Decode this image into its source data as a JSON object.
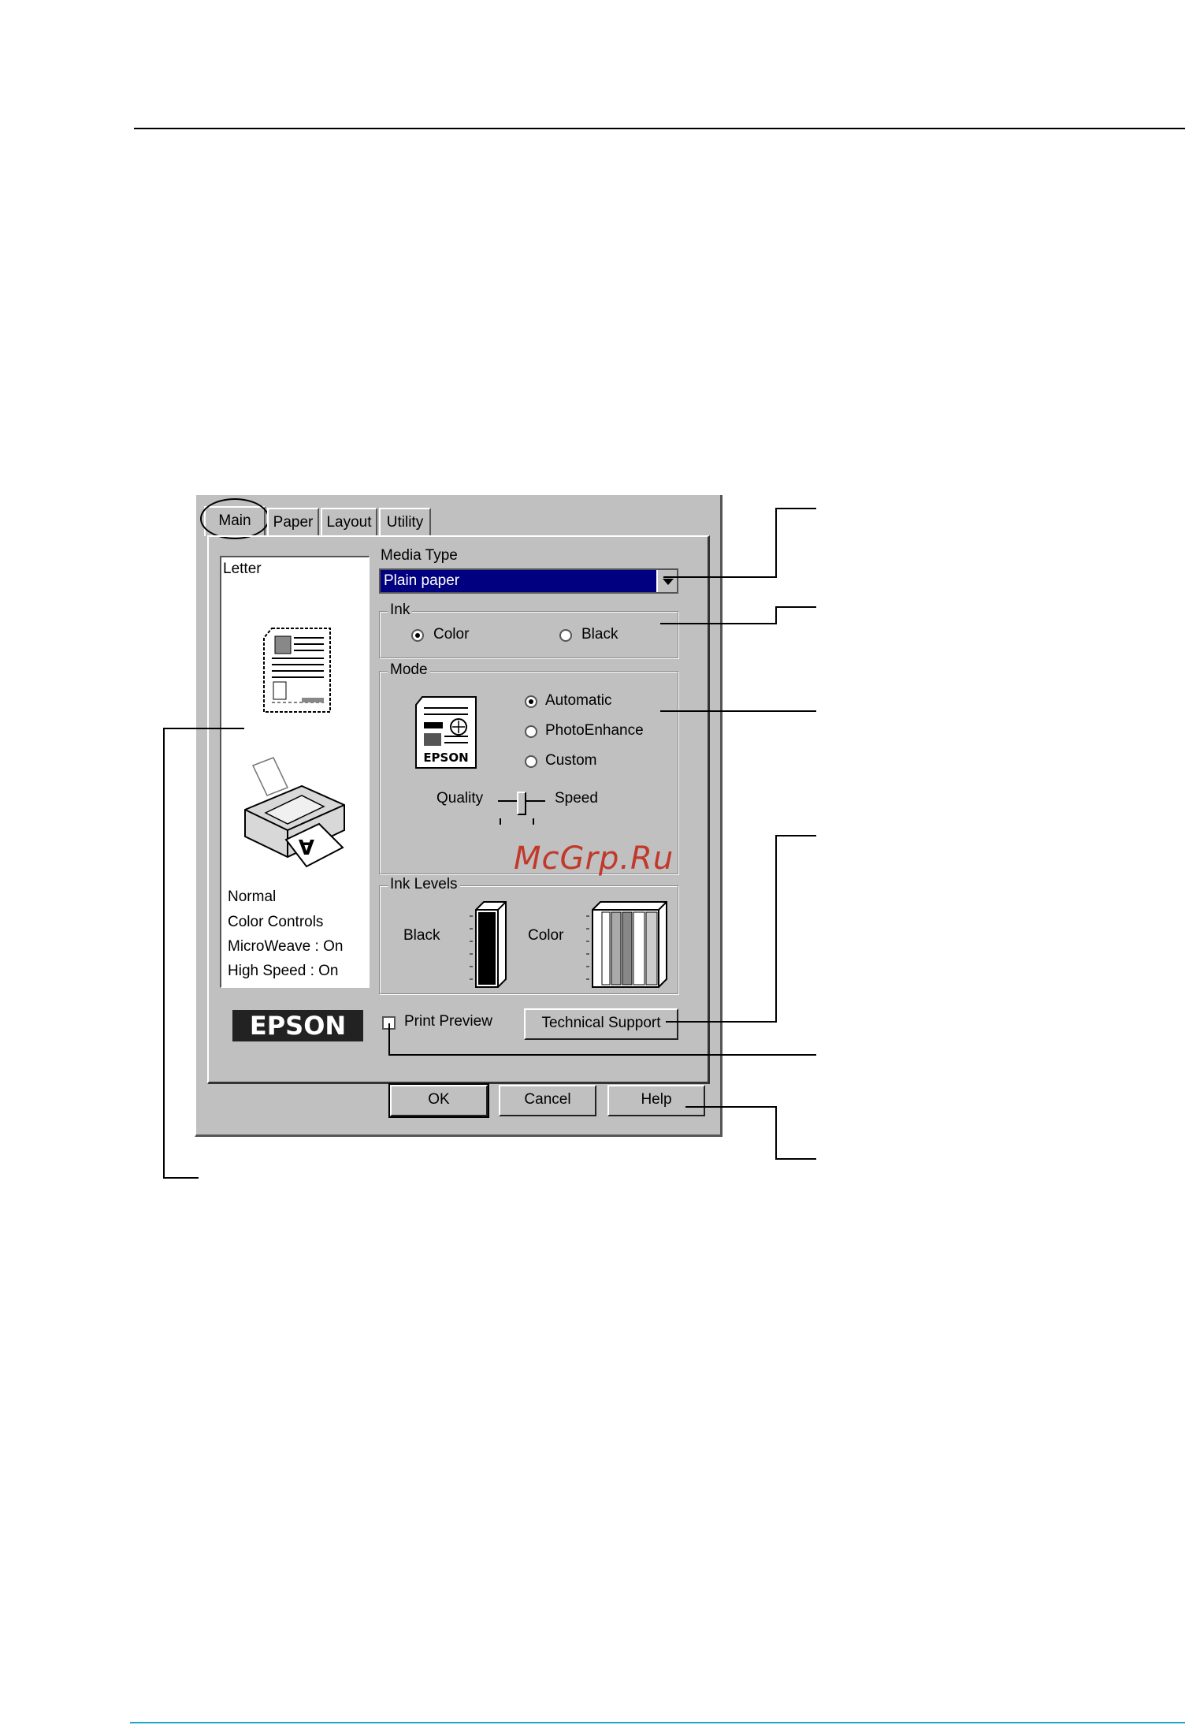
{
  "tabs": [
    {
      "label": "Main"
    },
    {
      "label": "Paper"
    },
    {
      "label": "Layout"
    },
    {
      "label": "Utility"
    }
  ],
  "preview": {
    "paper_size": "Letter",
    "settings": [
      "Normal",
      "Color Controls",
      "MicroWeave : On",
      "High Speed : On"
    ]
  },
  "media_type": {
    "label": "Media Type",
    "value": "Plain paper"
  },
  "ink": {
    "title": "Ink",
    "options": [
      "Color",
      "Black"
    ],
    "selected": "Color"
  },
  "mode": {
    "title": "Mode",
    "options": [
      "Automatic",
      "PhotoEnhance",
      "Custom"
    ],
    "selected": "Automatic",
    "icon_text": "EPSON",
    "slider_left": "Quality",
    "slider_right": "Speed",
    "slider_level": 0.5
  },
  "ink_levels": {
    "title": "Ink Levels",
    "black_label": "Black",
    "color_label": "Color",
    "black_level": 1.0,
    "color_level": 1.0
  },
  "brand": "EPSON",
  "print_preview": {
    "label": "Print Preview",
    "checked": false
  },
  "technical_support": "Technical Support",
  "buttons": {
    "ok": "OK",
    "cancel": "Cancel",
    "help": "Help"
  },
  "watermark": "McGrp.Ru"
}
